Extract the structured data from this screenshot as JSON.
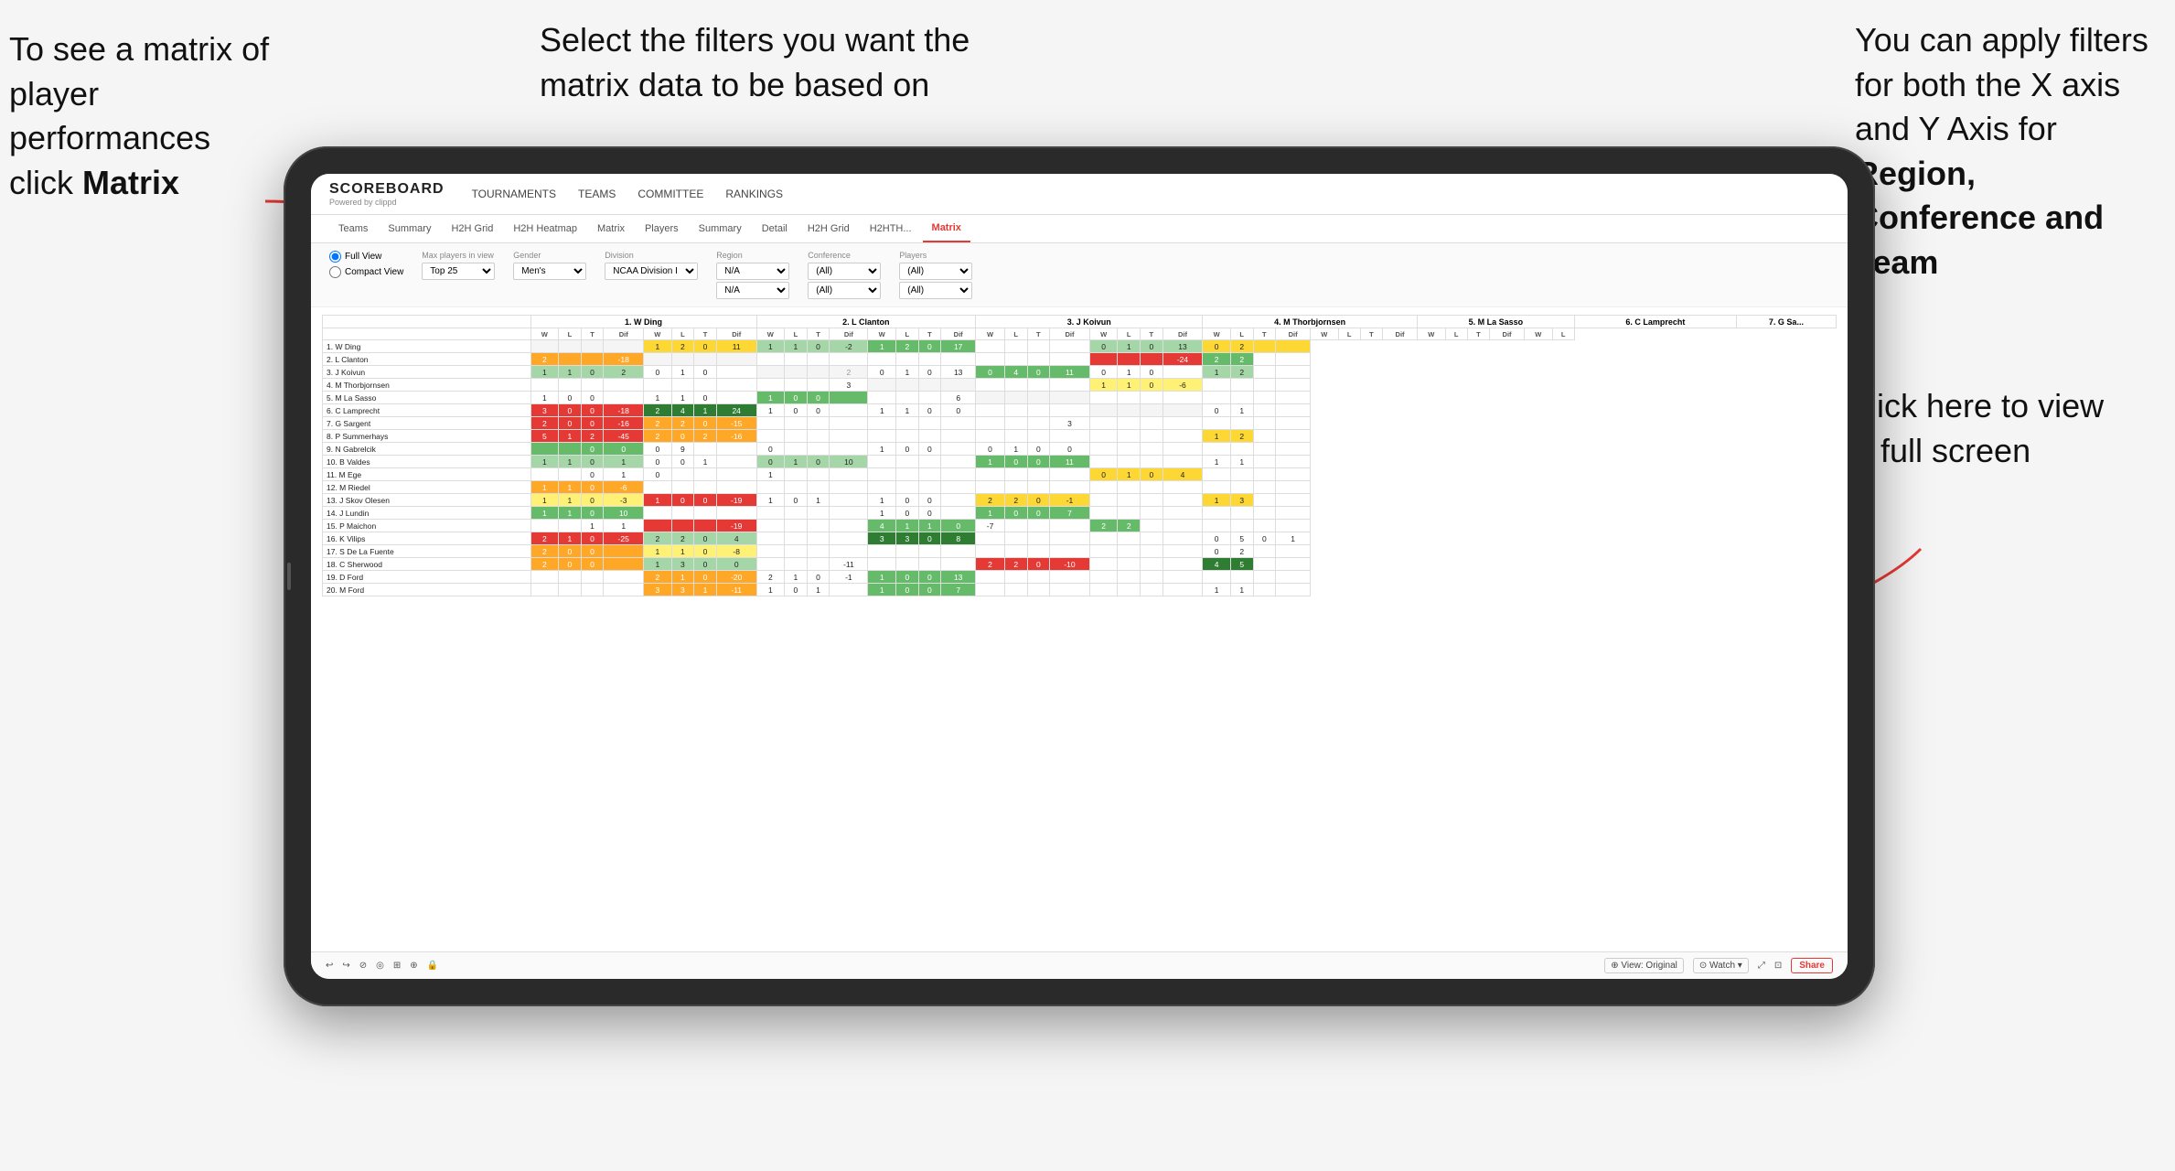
{
  "annotations": {
    "topleft": {
      "line1": "To see a matrix of",
      "line2": "player performances",
      "line3": "click ",
      "bold": "Matrix"
    },
    "topmid": {
      "text": "Select the filters you want the matrix data to be based on"
    },
    "topright": {
      "line1": "You  can apply filters for both the X axis and Y Axis for ",
      "bold": "Region, Conference and Team"
    },
    "bottomright": {
      "text": "Click here to view in full screen"
    }
  },
  "nav": {
    "logo": "SCOREBOARD",
    "logo_sub": "Powered by clippd",
    "items": [
      "TOURNAMENTS",
      "TEAMS",
      "COMMITTEE",
      "RANKINGS"
    ]
  },
  "sub_tabs": [
    {
      "label": "Teams",
      "active": false
    },
    {
      "label": "Summary",
      "active": false
    },
    {
      "label": "H2H Grid",
      "active": false
    },
    {
      "label": "H2H Heatmap",
      "active": false
    },
    {
      "label": "Matrix",
      "active": false
    },
    {
      "label": "Players",
      "active": false
    },
    {
      "label": "Summary",
      "active": false
    },
    {
      "label": "Detail",
      "active": false
    },
    {
      "label": "H2H Grid",
      "active": false
    },
    {
      "label": "H2HTH...",
      "active": false
    },
    {
      "label": "Matrix",
      "active": true
    }
  ],
  "filters": {
    "view_options": [
      "Full View",
      "Compact View"
    ],
    "max_players": {
      "label": "Max players in view",
      "value": "Top 25"
    },
    "gender": {
      "label": "Gender",
      "value": "Men's"
    },
    "division": {
      "label": "Division",
      "value": "NCAA Division I"
    },
    "region": {
      "label": "Region",
      "values": [
        "N/A",
        "N/A"
      ]
    },
    "conference": {
      "label": "Conference",
      "values": [
        "(All)",
        "(All)"
      ]
    },
    "players": {
      "label": "Players",
      "values": [
        "(All)",
        "(All)"
      ]
    }
  },
  "columns": [
    {
      "num": "1.",
      "name": "W Ding"
    },
    {
      "num": "2.",
      "name": "L Clanton"
    },
    {
      "num": "3.",
      "name": "J Koivun"
    },
    {
      "num": "4.",
      "name": "M Thorbjornsen"
    },
    {
      "num": "5.",
      "name": "M La Sasso"
    },
    {
      "num": "6.",
      "name": "C Lamprecht"
    },
    {
      "num": "7.",
      "name": "G Sa"
    }
  ],
  "rows": [
    {
      "name": "1. W Ding",
      "cells": [
        [
          "",
          "",
          "",
          "",
          "1",
          "2",
          "0",
          "11"
        ],
        [
          "1",
          "1",
          "0",
          "-2"
        ],
        [
          "1",
          "2",
          "0",
          "17"
        ],
        [
          "0",
          "0",
          "",
          ""
        ],
        [
          "0",
          "1",
          "0",
          "13"
        ],
        [
          "0",
          "2",
          ""
        ]
      ]
    },
    {
      "name": "2. L Clanton",
      "cells": [
        [
          "2",
          "",
          "",
          "-18"
        ],
        [
          "",
          "",
          "",
          ""
        ],
        [
          "",
          "",
          "",
          ""
        ],
        [
          "",
          "",
          "",
          ""
        ],
        [
          "",
          "",
          "",
          "-24"
        ],
        [
          "2",
          "2",
          ""
        ]
      ]
    },
    {
      "name": "3. J Koivun",
      "cells": [
        [
          "1",
          "1",
          "0",
          "2"
        ],
        [
          "0",
          "1",
          "0",
          ""
        ],
        [
          "",
          "",
          "",
          "2"
        ],
        [
          "0",
          "1",
          "0",
          "13"
        ],
        [
          "0",
          "4",
          "0",
          "11"
        ],
        [
          "0",
          "1",
          "0",
          ""
        ],
        [
          "1",
          "2",
          ""
        ]
      ]
    },
    {
      "name": "4. M Thorbjornsen",
      "cells": [
        [
          "",
          "",
          "",
          ""
        ],
        [
          "",
          "",
          "",
          ""
        ],
        [
          "",
          "",
          "",
          "3"
        ],
        [
          "",
          "",
          "",
          ""
        ],
        [
          "",
          "",
          "",
          ""
        ],
        [
          "1",
          "1",
          "0",
          "-6"
        ],
        [
          "",
          ""
        ]
      ]
    },
    {
      "name": "5. M La Sasso",
      "cells": [
        [
          "1",
          "0",
          "0",
          ""
        ],
        [
          "1",
          "1",
          "0",
          ""
        ],
        [
          "1",
          "0",
          "0",
          ""
        ],
        [
          "",
          "",
          "",
          "6"
        ],
        [
          "",
          "",
          "",
          ""
        ],
        [
          "",
          "",
          "",
          ""
        ],
        [
          "",
          ""
        ]
      ]
    },
    {
      "name": "6. C Lamprecht",
      "cells": [
        [
          "3",
          "0",
          "0",
          "-18"
        ],
        [
          "2",
          "4",
          "1",
          "24"
        ],
        [
          "1",
          "0",
          "0",
          ""
        ],
        [
          "1",
          "1",
          "0",
          "0"
        ],
        [
          "",
          "",
          "",
          ""
        ],
        [
          "",
          "",
          "",
          ""
        ],
        [
          "0",
          "1"
        ]
      ]
    },
    {
      "name": "7. G Sargent",
      "cells": [
        [
          "2",
          "0",
          "0",
          "-16"
        ],
        [
          "2",
          "2",
          "0",
          "-15"
        ],
        [
          "",
          "",
          "",
          ""
        ],
        [
          "",
          "",
          "",
          ""
        ],
        [
          "",
          "",
          "",
          "3"
        ],
        [
          "",
          "",
          "",
          ""
        ],
        [
          "",
          ""
        ]
      ]
    },
    {
      "name": "8. P Summerhays",
      "cells": [
        [
          "5",
          "1",
          "2",
          "-45"
        ],
        [
          "2",
          "0",
          "2",
          "-16"
        ],
        [
          "",
          "",
          "",
          ""
        ],
        [
          "",
          "",
          "",
          ""
        ],
        [
          "",
          "",
          "",
          ""
        ],
        [
          "",
          "",
          "",
          ""
        ],
        [
          "1",
          "2"
        ]
      ]
    },
    {
      "name": "9. N Gabrelcik",
      "cells": [
        [
          "",
          "",
          "",
          "0",
          "0",
          "0",
          "9"
        ],
        [
          "",
          "",
          "",
          "0"
        ],
        [
          "1",
          "0",
          "0",
          ""
        ],
        [
          "0",
          "1",
          "0",
          "0"
        ],
        [
          "",
          "",
          "",
          ""
        ],
        [
          "",
          "",
          "",
          ""
        ]
      ]
    },
    {
      "name": "10. B Valdes",
      "cells": [
        [
          "1",
          "1",
          "0",
          "1"
        ],
        [
          "0",
          "0",
          "1",
          ""
        ],
        [
          "0",
          "1",
          "0",
          "10"
        ],
        [
          "",
          "",
          "",
          ""
        ],
        [
          "1",
          "0",
          "0",
          "11"
        ],
        [
          "",
          "",
          "",
          ""
        ],
        [
          "1",
          "1"
        ]
      ]
    },
    {
      "name": "11. M Ege",
      "cells": [
        [
          "",
          "",
          "",
          "",
          "0",
          "1",
          "0"
        ],
        [
          "",
          "",
          "",
          "1"
        ],
        [
          "",
          "",
          "",
          ""
        ],
        [
          "",
          "",
          "",
          ""
        ],
        [
          "",
          "",
          "",
          "0",
          "1",
          "0",
          "4"
        ]
      ]
    },
    {
      "name": "12. M Riedel",
      "cells": [
        [
          "1",
          "1",
          "0",
          "-6"
        ],
        [
          "",
          "",
          "",
          ""
        ],
        [
          "",
          "",
          "",
          ""
        ],
        [
          "",
          "",
          "",
          ""
        ],
        [
          "",
          "",
          "",
          ""
        ],
        [
          "",
          "",
          "",
          ""
        ],
        [
          "",
          ""
        ]
      ]
    },
    {
      "name": "13. J Skov Olesen",
      "cells": [
        [
          "1",
          "1",
          "0",
          "-3"
        ],
        [
          "1",
          "0",
          "0",
          "-19"
        ],
        [
          "1",
          "0",
          "1",
          ""
        ],
        [
          "1",
          "0",
          "0",
          ""
        ],
        [
          "2",
          "2",
          "0",
          "-1"
        ],
        [
          "",
          "",
          "",
          ""
        ],
        [
          "1",
          "3"
        ]
      ]
    },
    {
      "name": "14. J Lundin",
      "cells": [
        [
          "1",
          "1",
          "0",
          "10"
        ],
        [
          "",
          "",
          "",
          ""
        ],
        [
          "",
          "",
          "",
          ""
        ],
        [
          "1",
          "0",
          "0",
          ""
        ],
        [
          "1",
          "0",
          "0",
          "7"
        ],
        [
          "",
          "",
          "",
          ""
        ],
        [
          "",
          ""
        ]
      ]
    },
    {
      "name": "15. P Maichon",
      "cells": [
        [
          "",
          "",
          "",
          "",
          "1",
          "1",
          "",
          "",
          "-19"
        ],
        [
          "",
          "",
          "",
          ""
        ],
        [
          "4",
          "1",
          "1",
          "0",
          "-7"
        ],
        [
          "",
          "",
          "",
          ""
        ],
        [
          "2",
          "2",
          ""
        ]
      ]
    },
    {
      "name": "16. K Vilips",
      "cells": [
        [
          "2",
          "1",
          "0",
          "-25"
        ],
        [
          "2",
          "2",
          "0",
          "4"
        ],
        [
          "",
          "",
          "",
          ""
        ],
        [
          "3",
          "3",
          "0",
          "8"
        ],
        [
          "",
          "",
          "",
          ""
        ],
        [
          "",
          "",
          "",
          "0",
          "5",
          "0",
          "1"
        ]
      ]
    },
    {
      "name": "17. S De La Fuente",
      "cells": [
        [
          "2",
          "0",
          "0",
          ""
        ],
        [
          "1",
          "1",
          "0",
          "-8"
        ],
        [
          "",
          "",
          "",
          ""
        ],
        [
          "",
          "",
          "",
          ""
        ],
        [
          "",
          "",
          "",
          ""
        ],
        [
          "",
          "",
          "",
          "0",
          "2"
        ]
      ]
    },
    {
      "name": "18. C Sherwood",
      "cells": [
        [
          "2",
          "0",
          "0",
          ""
        ],
        [
          "1",
          "3",
          "0",
          "0"
        ],
        [
          "",
          "",
          "",
          "",
          "-11"
        ],
        [
          "",
          "",
          "",
          ""
        ],
        [
          "2",
          "2",
          "0",
          "-10"
        ],
        [
          "",
          "",
          "",
          ""
        ],
        [
          "4",
          "5"
        ]
      ]
    },
    {
      "name": "19. D Ford",
      "cells": [
        [
          "",
          "",
          "",
          ""
        ],
        [
          "2",
          "1",
          "0",
          "-20"
        ],
        [
          "2",
          "1",
          "0",
          "-1"
        ],
        [
          "1",
          "0",
          "0",
          "13"
        ],
        [
          "",
          "",
          "",
          ""
        ],
        [
          "",
          "",
          "",
          ""
        ],
        [
          "",
          ""
        ]
      ]
    },
    {
      "name": "20. M Ford",
      "cells": [
        [
          "",
          "",
          "",
          ""
        ],
        [
          "3",
          "3",
          "1",
          "-11"
        ],
        [
          "1",
          "0",
          "1",
          ""
        ],
        [
          "1",
          "0",
          "0",
          "7"
        ],
        [
          "",
          "",
          "",
          ""
        ],
        [
          "",
          "",
          "",
          ""
        ],
        [
          "1",
          "1"
        ]
      ]
    }
  ],
  "toolbar": {
    "view_label": "⊕ View: Original",
    "watch": "⊙ Watch ▾",
    "share": "Share",
    "icons": [
      "↩",
      "↪",
      "⊘",
      "◎",
      "⊞",
      "⊕",
      "🔒"
    ]
  }
}
